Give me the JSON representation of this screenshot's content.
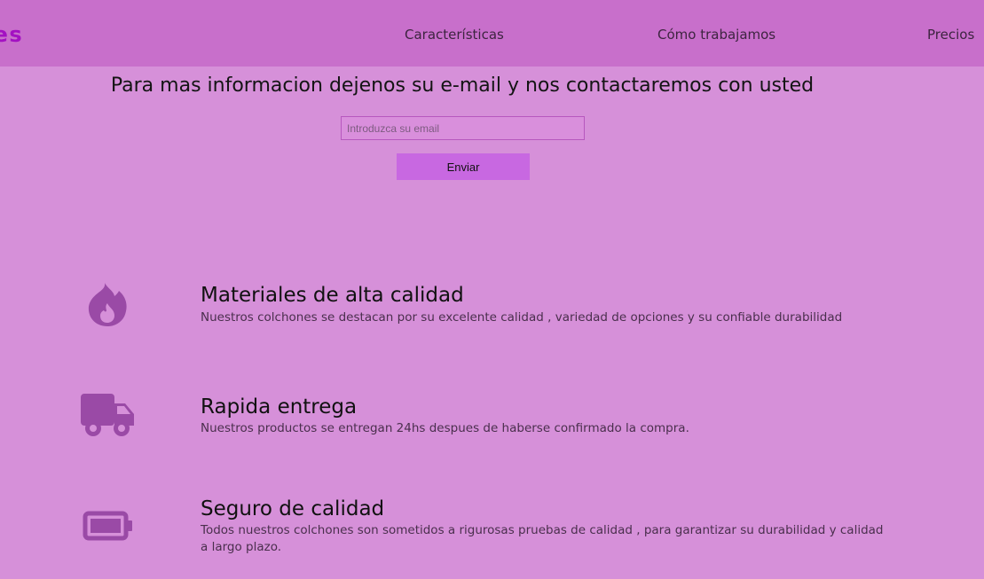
{
  "header": {
    "logo_text": "ones",
    "nav": [
      {
        "label": "Características"
      },
      {
        "label": "Cómo trabajamos"
      },
      {
        "label": "Precios"
      }
    ]
  },
  "contact": {
    "heading": "Para mas informacion dejenos su e-mail y nos contactaremos con usted",
    "email_placeholder": "Introduzca su email",
    "email_value": "",
    "submit_label": "Enviar"
  },
  "features": [
    {
      "icon": "fire-icon",
      "title": "Materiales de alta calidad",
      "description": "Nuestros colchones se destacan por su excelente calidad , variedad de opciones y su confiable durabilidad"
    },
    {
      "icon": "truck-icon",
      "title": "Rapida entrega",
      "description": "Nuestros productos se entregan 24hs despues de haberse confirmado la compra."
    },
    {
      "icon": "battery-icon",
      "title": "Seguro de calidad",
      "description": "Todos nuestros colchones son sometidos a rigurosas pruebas de calidad , para garantizar su durabilidad y calidad a largo plazo."
    }
  ],
  "colors": {
    "background": "#d690d9",
    "header": "#c86fcb",
    "logo": "#a311c2",
    "icon": "#9a4aa6",
    "button": "#c868e1"
  }
}
